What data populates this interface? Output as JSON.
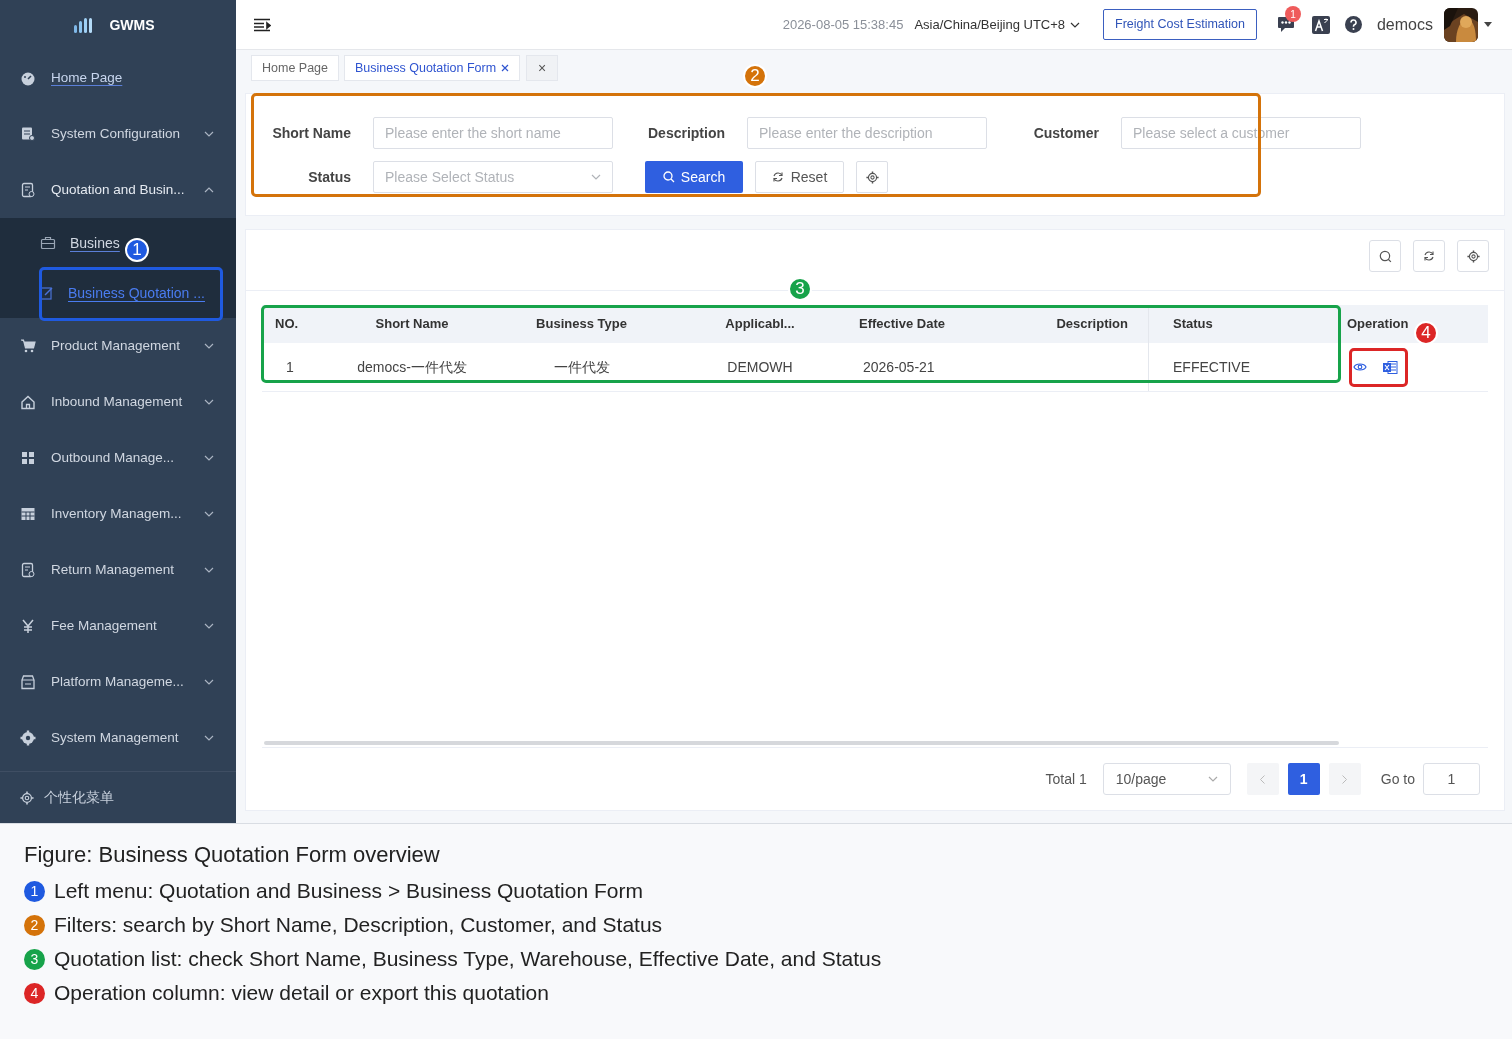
{
  "sidebar": {
    "logo": "GWMS",
    "items": [
      {
        "label": "Home Page",
        "kind": "link"
      },
      {
        "label": "System Configuration",
        "kind": "group",
        "expanded": false
      },
      {
        "label": "Quotation and Busin...",
        "kind": "group",
        "expanded": true,
        "children": [
          {
            "label": "Busines",
            "selected": false
          },
          {
            "label": "Business Quotation ...",
            "selected": true
          }
        ]
      },
      {
        "label": "Product Management",
        "kind": "group",
        "expanded": false
      },
      {
        "label": "Inbound Management",
        "kind": "group",
        "expanded": false
      },
      {
        "label": "Outbound Manage...",
        "kind": "group",
        "expanded": false
      },
      {
        "label": "Inventory Managem...",
        "kind": "group",
        "expanded": false
      },
      {
        "label": "Return Management",
        "kind": "group",
        "expanded": false
      },
      {
        "label": "Fee Management",
        "kind": "group",
        "expanded": false
      },
      {
        "label": "Platform Manageme...",
        "kind": "group",
        "expanded": false
      },
      {
        "label": "System Management",
        "kind": "group",
        "expanded": false
      }
    ],
    "footer": "个性化菜单"
  },
  "header": {
    "datetime": "2026-08-05 15:38:45",
    "timezone": "Asia/China/Beijing UTC+8",
    "action": "Freight Cost Estimation",
    "notification_count": "1",
    "user": "democs"
  },
  "tabs": [
    {
      "label": "Home Page",
      "selected": false,
      "closable": false
    },
    {
      "label": "Business Quotation Form",
      "selected": true,
      "closable": true
    }
  ],
  "close_all": "×",
  "filters": {
    "fields": [
      {
        "label": "Short Name",
        "placeholder": "Please enter the short name",
        "kind": "input"
      },
      {
        "label": "Description",
        "placeholder": "Please enter the description",
        "kind": "input"
      },
      {
        "label": "Customer",
        "placeholder": "Please select a customer",
        "kind": "input"
      },
      {
        "label": "Status",
        "placeholder": "Please Select Status",
        "kind": "select"
      }
    ],
    "search": "Search",
    "reset": "Reset"
  },
  "table": {
    "columns": [
      "NO.",
      "Short Name",
      "Business Type",
      "Applicabl...",
      "Effective Date",
      "Description",
      "Status",
      "Operation"
    ],
    "rows": [
      {
        "cells": [
          "1",
          "democs-一件代发",
          "一件代发",
          "DEMOWH",
          "2026-05-21",
          "",
          "EFFECTIVE"
        ]
      }
    ]
  },
  "pagination": {
    "total": "Total 1",
    "page_size": "10/page",
    "pages": [
      {
        "label": "1",
        "selected": true
      }
    ],
    "goto_label": "Go to",
    "goto_value": "1"
  },
  "annotations": [
    {
      "number": "1",
      "callout_number": "1",
      "color": "#1f5ae0",
      "caption": "Left menu: Quotation and Business > Business Quotation Form"
    },
    {
      "number": "2",
      "callout_number": "2",
      "color": "#d4730a",
      "caption": "Filters: search by Short Name, Description, Customer, and Status"
    },
    {
      "number": "3",
      "callout_number": "3",
      "color": "#17a34a",
      "caption": "Quotation list: check Short Name, Business Type, Warehouse, Effective Date, and Status"
    },
    {
      "number": "4",
      "callout_number": "4",
      "color": "#dc2626",
      "caption": "Operation column: view detail or export this quotation"
    }
  ],
  "figure_title": "Figure: Business Quotation Form overview"
}
